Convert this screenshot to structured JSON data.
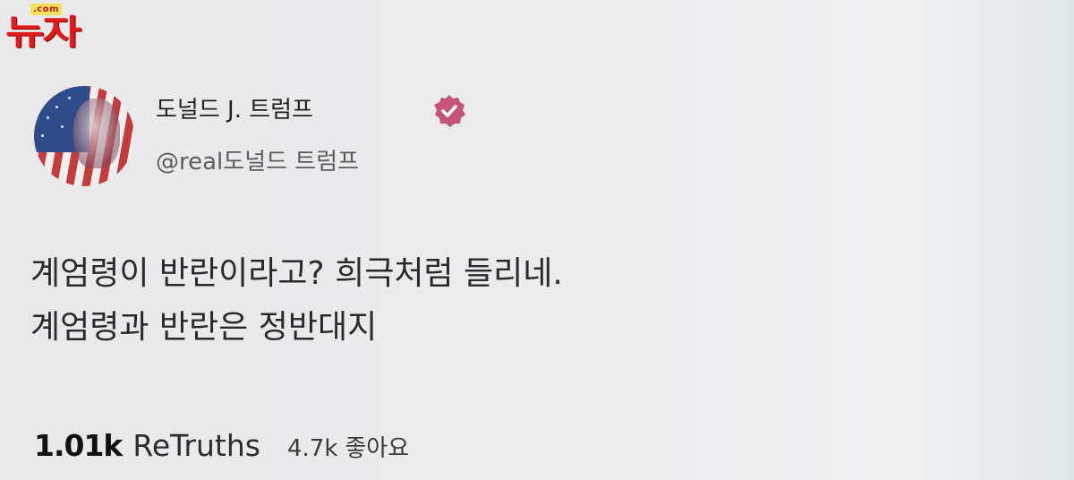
{
  "watermark": {
    "domain_suffix": ".com",
    "brand": "뉴자"
  },
  "post": {
    "author": {
      "display_name": "도널드 J. 트럼프",
      "handle": "@real도널드 트럼프",
      "verified": true,
      "avatar": "flag-portrait-avatar"
    },
    "text_lines": [
      "계엄령이 반란이라고? 희극처럼 들리네.",
      "계엄령과 반란은 정반대지"
    ],
    "stats": {
      "retruths_count": "1.01k",
      "retruths_label": "ReTruths",
      "likes_count": "4.7k",
      "likes_label": "좋아요"
    }
  },
  "colors": {
    "background": "#ececef",
    "watermark_red": "#e11a1a",
    "badge": "#c5537a"
  },
  "icons": {
    "verified": "verified-badge-icon",
    "checkmark": "checkmark-icon"
  }
}
